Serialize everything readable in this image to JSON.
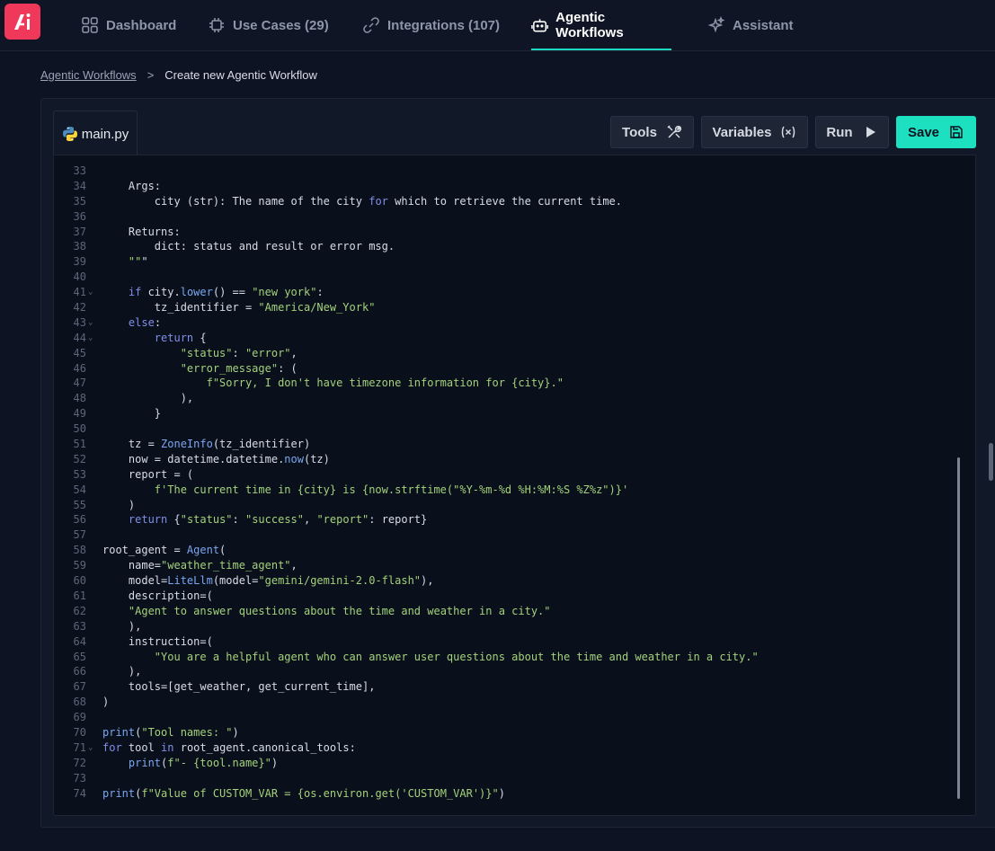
{
  "nav": {
    "items": [
      {
        "label": "Dashboard",
        "icon": "grid-icon"
      },
      {
        "label": "Use Cases (29)",
        "icon": "chip-icon"
      },
      {
        "label": "Integrations (107)",
        "icon": "link-icon"
      },
      {
        "label": "Agentic Workflows",
        "icon": "robot-icon"
      },
      {
        "label": "Assistant",
        "icon": "sparkle-icon"
      }
    ],
    "active": "Agentic Workflows"
  },
  "breadcrumb": {
    "link": "Agentic Workflows",
    "separator": ">",
    "current": "Create new Agentic Workflow"
  },
  "editor": {
    "file_tab": "main.py",
    "buttons": {
      "tools": "Tools",
      "variables": "Variables",
      "run": "Run",
      "save": "Save"
    },
    "lines": [
      {
        "n": "33",
        "t": ""
      },
      {
        "n": "34",
        "t": "    Args:"
      },
      {
        "n": "35",
        "t": "        city (str): The name of the city for which to retrieve the current time."
      },
      {
        "n": "36",
        "t": ""
      },
      {
        "n": "37",
        "t": "    Returns:"
      },
      {
        "n": "38",
        "t": "        dict: status and result or error msg."
      },
      {
        "n": "39",
        "t": "    \"\"\""
      },
      {
        "n": "40",
        "t": ""
      },
      {
        "n": "41",
        "t": "    if city.lower() == \"new york\":",
        "fold": true
      },
      {
        "n": "42",
        "t": "        tz_identifier = \"America/New_York\""
      },
      {
        "n": "43",
        "t": "    else:",
        "fold": true
      },
      {
        "n": "44",
        "t": "        return {",
        "fold": true
      },
      {
        "n": "45",
        "t": "            \"status\": \"error\","
      },
      {
        "n": "46",
        "t": "            \"error_message\": ("
      },
      {
        "n": "47",
        "t": "                f\"Sorry, I don't have timezone information for {city}.\""
      },
      {
        "n": "48",
        "t": "            ),"
      },
      {
        "n": "49",
        "t": "        }"
      },
      {
        "n": "50",
        "t": ""
      },
      {
        "n": "51",
        "t": "    tz = ZoneInfo(tz_identifier)"
      },
      {
        "n": "52",
        "t": "    now = datetime.datetime.now(tz)"
      },
      {
        "n": "53",
        "t": "    report = ("
      },
      {
        "n": "54",
        "t": "        f'The current time in {city} is {now.strftime(\"%Y-%m-%d %H:%M:%S %Z%z\")}'"
      },
      {
        "n": "55",
        "t": "    )"
      },
      {
        "n": "56",
        "t": "    return {\"status\": \"success\", \"report\": report}"
      },
      {
        "n": "57",
        "t": ""
      },
      {
        "n": "58",
        "t": "root_agent = Agent("
      },
      {
        "n": "59",
        "t": "    name=\"weather_time_agent\","
      },
      {
        "n": "60",
        "t": "    model=LiteLlm(model=\"gemini/gemini-2.0-flash\"),"
      },
      {
        "n": "61",
        "t": "    description=("
      },
      {
        "n": "62",
        "t": "    \"Agent to answer questions about the time and weather in a city.\""
      },
      {
        "n": "63",
        "t": "    ),"
      },
      {
        "n": "64",
        "t": "    instruction=("
      },
      {
        "n": "65",
        "t": "        \"You are a helpful agent who can answer user questions about the time and weather in a city.\""
      },
      {
        "n": "66",
        "t": "    ),"
      },
      {
        "n": "67",
        "t": "    tools=[get_weather, get_current_time],"
      },
      {
        "n": "68",
        "t": ")"
      },
      {
        "n": "69",
        "t": ""
      },
      {
        "n": "70",
        "t": "print(\"Tool names: \")"
      },
      {
        "n": "71",
        "t": "for tool in root_agent.canonical_tools:",
        "fold": true
      },
      {
        "n": "72",
        "t": "    print(f\"- {tool.name}\")"
      },
      {
        "n": "73",
        "t": ""
      },
      {
        "n": "74",
        "t": "print(f\"Value of CUSTOM_VAR = {os.environ.get('CUSTOM_VAR')}\")"
      }
    ]
  },
  "colors": {
    "accent": "#1de0c1",
    "logo": "#f0385a"
  }
}
